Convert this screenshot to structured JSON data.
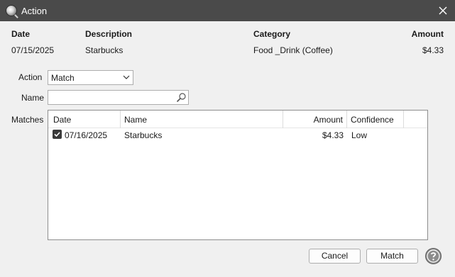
{
  "window": {
    "title": "Action"
  },
  "transaction": {
    "headers": {
      "date": "Date",
      "description": "Description",
      "category": "Category",
      "amount": "Amount"
    },
    "values": {
      "date": "07/15/2025",
      "description": "Starbucks",
      "category": "Food _Drink (Coffee)",
      "amount": "$4.33"
    }
  },
  "form": {
    "action_label": "Action",
    "action_value": "Match",
    "name_label": "Name",
    "name_value": "",
    "matches_label": "Matches"
  },
  "matches": {
    "columns": {
      "date": "Date",
      "name": "Name",
      "amount": "Amount",
      "confidence": "Confidence"
    },
    "rows": [
      {
        "checked": true,
        "date": "07/16/2025",
        "name": "Starbucks",
        "amount": "$4.33",
        "confidence": "Low"
      }
    ]
  },
  "buttons": {
    "cancel": "Cancel",
    "match": "Match"
  },
  "icons": {
    "app": "magnifier-app-icon",
    "close": "close-icon",
    "dropdown": "chevron-down-icon",
    "search": "search-icon",
    "checkbox": "checkmark-icon",
    "help": "help-icon"
  }
}
